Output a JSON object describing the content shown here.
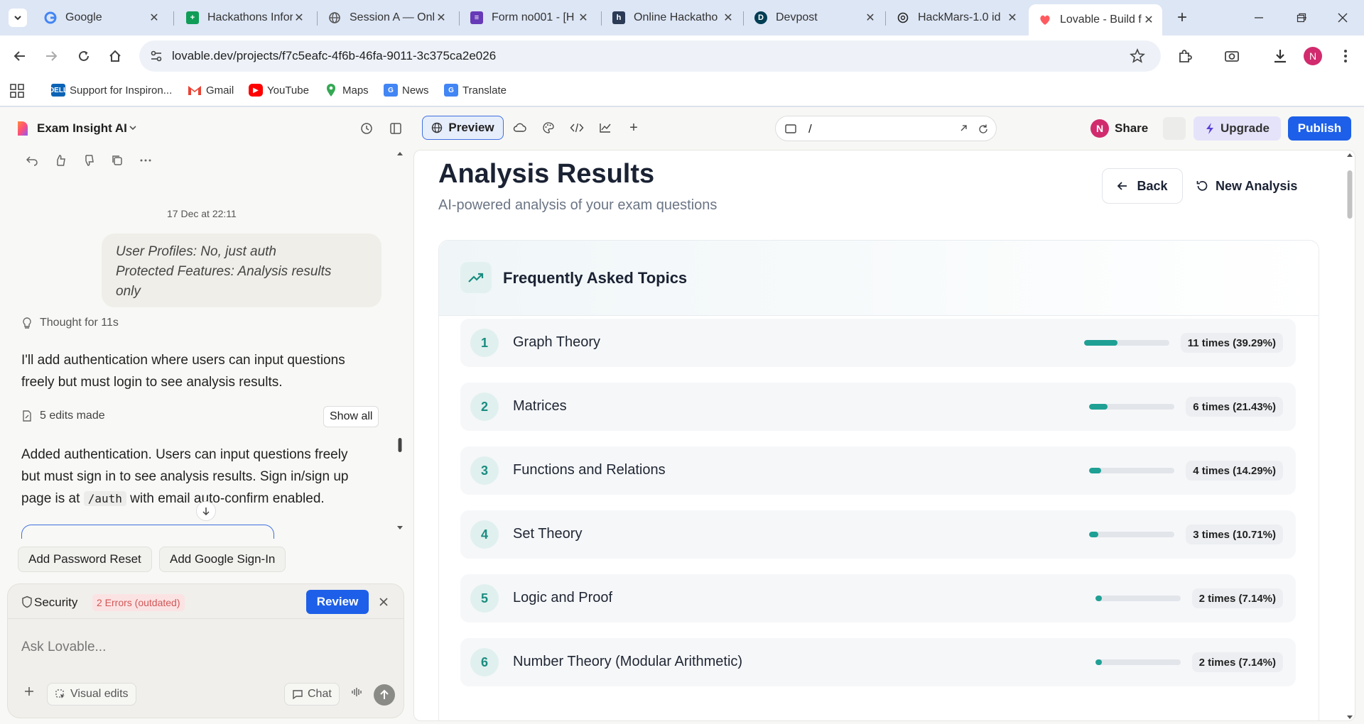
{
  "browser": {
    "tabs": [
      {
        "title": "Google",
        "favicon": "google-favicon",
        "color": "#4285f4"
      },
      {
        "title": "Hackathons Infor",
        "favicon": "sheets-favicon",
        "color": "#0f9d58"
      },
      {
        "title": "Session A — Onl",
        "favicon": "globe-favicon",
        "color": "#555555"
      },
      {
        "title": "Form no001 - [H",
        "favicon": "forms-favicon",
        "color": "#673ab7"
      },
      {
        "title": "Online Hackatho",
        "favicon": "hackerearth-favicon",
        "color": "#2b3a55"
      },
      {
        "title": "Devpost",
        "favicon": "devpost-favicon",
        "color": "#003e54"
      },
      {
        "title": "HackMars-1.0 id",
        "favicon": "openai-favicon",
        "color": "#222222"
      },
      {
        "title": "Lovable - Build f",
        "favicon": "lovable-favicon",
        "color": "#ff5a5f"
      }
    ],
    "url": "lovable.dev/projects/f7c5eafc-4f6b-46fa-9011-3c375ca2e026",
    "profile_initial": "N",
    "bookmarks": [
      {
        "label": "Support for Inspiron...",
        "icon": "dell-icon"
      },
      {
        "label": "Gmail",
        "icon": "gmail-icon"
      },
      {
        "label": "YouTube",
        "icon": "youtube-icon"
      },
      {
        "label": "Maps",
        "icon": "maps-icon"
      },
      {
        "label": "News",
        "icon": "news-icon"
      },
      {
        "label": "Translate",
        "icon": "translate-icon"
      }
    ]
  },
  "sidebar": {
    "project_name": "Exam Insight AI",
    "date": "17 Dec at 22:11",
    "user_message_line1": "User Profiles: No, just auth",
    "user_message_line2": "Protected Features: Analysis results",
    "user_message_line3": "only",
    "thought": "Thought for 11s",
    "reply1_line1": "I'll add authentication where users can input questions",
    "reply1_line2": "freely but must login to see analysis results.",
    "edits": "5 edits made",
    "show_all": "Show all",
    "reply2_line1": "Added authentication. Users can input questions freely",
    "reply2_line2": "but must sign in to see analysis results. Sign in/sign up",
    "reply2_pre": "page is at",
    "reply2_code": "/auth",
    "reply2_post": "with email auto-confirm enabled.",
    "suggestions": [
      "Add Password Reset",
      "Add Google Sign-In"
    ],
    "security_label": "Security",
    "security_badge": "2 Errors (outdated)",
    "review": "Review",
    "input_placeholder": "Ask Lovable...",
    "visual_edits": "Visual edits",
    "chat": "Chat"
  },
  "topbar": {
    "preview": "Preview",
    "path": "/",
    "share": "Share",
    "share_avatar": "N",
    "upgrade": "Upgrade",
    "publish": "Publish"
  },
  "page": {
    "title": "Analysis Results",
    "subtitle": "AI-powered analysis of your exam questions",
    "back": "Back",
    "new_analysis": "New Analysis",
    "card_title": "Frequently Asked Topics",
    "topics": [
      {
        "rank": "1",
        "name": "Graph Theory",
        "count": "11 times (39.29%)",
        "fraction": 0.3929
      },
      {
        "rank": "2",
        "name": "Matrices",
        "count": "6 times (21.43%)",
        "fraction": 0.2143
      },
      {
        "rank": "3",
        "name": "Functions and Relations",
        "count": "4 times (14.29%)",
        "fraction": 0.1429
      },
      {
        "rank": "4",
        "name": "Set Theory",
        "count": "3 times (10.71%)",
        "fraction": 0.1071
      },
      {
        "rank": "5",
        "name": "Logic and Proof",
        "count": "2 times (7.14%)",
        "fraction": 0.0714
      },
      {
        "rank": "6",
        "name": "Number Theory (Modular Arithmetic)",
        "count": "2 times (7.14%)",
        "fraction": 0.0714
      }
    ],
    "accent": "#1fa094"
  }
}
